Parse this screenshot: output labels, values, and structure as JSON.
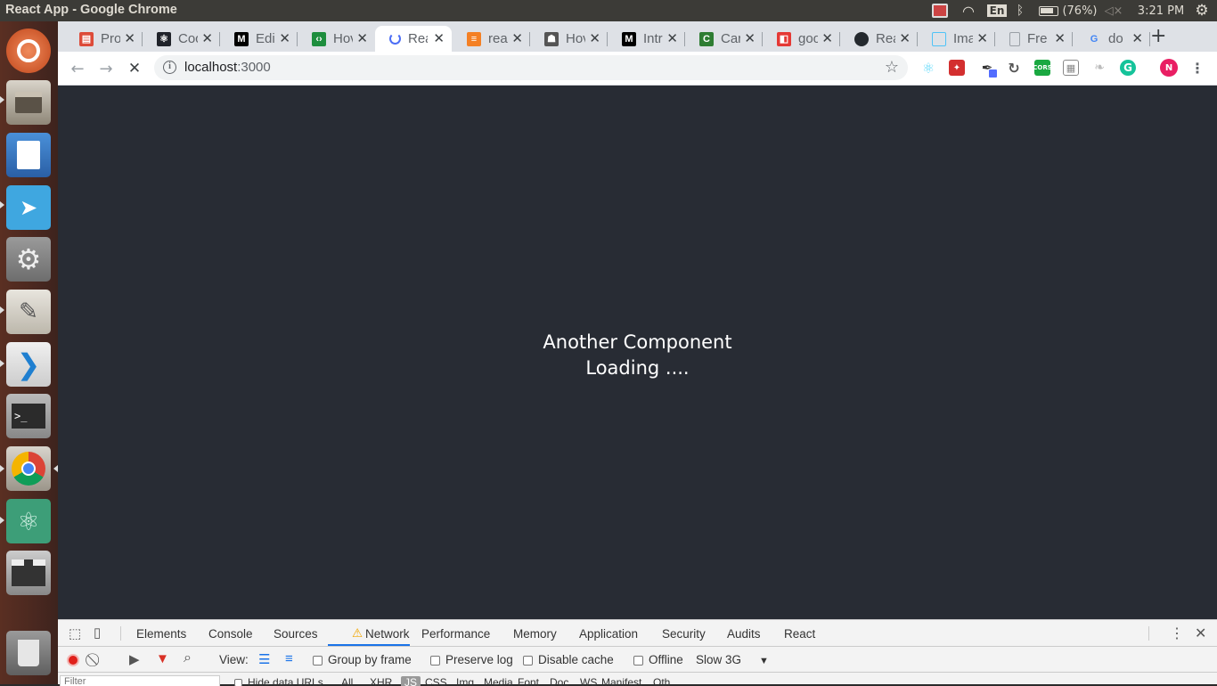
{
  "topbar": {
    "title": "React App - Google Chrome",
    "keyboard_layout": "En",
    "battery": "(76%)",
    "time": "3:21 PM"
  },
  "launcher": {
    "items": [
      "ubuntu-logo-icon",
      "files-icon",
      "writer-icon",
      "telegram-icon",
      "settings-icon",
      "text-editor-icon",
      "vscode-icon",
      "terminal-icon",
      "chrome-icon",
      "atom-icon",
      "video-editor-icon",
      "trash-icon"
    ]
  },
  "browser": {
    "tabs": [
      {
        "label": "Pro",
        "icon": "doc-icon",
        "color": "#dd4b39"
      },
      {
        "label": "Coc",
        "icon": "react-icon",
        "color": "#20232a"
      },
      {
        "label": "Edi",
        "icon": "medium-icon",
        "color": "#000000"
      },
      {
        "label": "Hov",
        "icon": "code-icon",
        "color": "#1e8e3e"
      },
      {
        "label": "Rea",
        "icon": "loading-icon",
        "color": "#4c6ef5",
        "active": true
      },
      {
        "label": "rea",
        "icon": "stackoverflow-icon",
        "color": "#f48024"
      },
      {
        "label": "Hov",
        "icon": "hacker-icon",
        "color": "#555555"
      },
      {
        "label": "Intr",
        "icon": "medium-icon",
        "color": "#000000"
      },
      {
        "label": "Car",
        "icon": "c-icon",
        "color": "#2e7d32"
      },
      {
        "label": "goo",
        "icon": "netlify-icon",
        "color": "#e53935"
      },
      {
        "label": "Rea",
        "icon": "github-icon",
        "color": "#24292e"
      },
      {
        "label": "Ima",
        "icon": "image-icon",
        "color": "#4fc3f7"
      },
      {
        "label": "Fre",
        "icon": "page-icon",
        "color": "#9aa0a6"
      },
      {
        "label": "do ",
        "icon": "google-icon",
        "color": "#4285f4"
      }
    ],
    "url_host": "localhost",
    "url_port": ":3000",
    "profile_initial": "N"
  },
  "page": {
    "line1": "Another Component",
    "line2": "Loading ....",
    "background": "#282c34"
  },
  "devtools": {
    "tabs": [
      "Elements",
      "Console",
      "Sources",
      "Network",
      "Performance",
      "Memory",
      "Application",
      "Security",
      "Audits",
      "React"
    ],
    "active_tab": "Network",
    "view_label": "View:",
    "group_by_frame": "Group by frame",
    "preserve_log": "Preserve log",
    "disable_cache": "Disable cache",
    "offline": "Offline",
    "throttle": "Slow 3G",
    "filter_placeholder": "Filter",
    "hide_data_urls": "Hide data URLs",
    "filter_types": [
      "All",
      "XHR",
      "JS",
      "CSS",
      "Img",
      "Media",
      "Font",
      "Doc",
      "WS",
      "Manifest",
      "Oth"
    ]
  }
}
